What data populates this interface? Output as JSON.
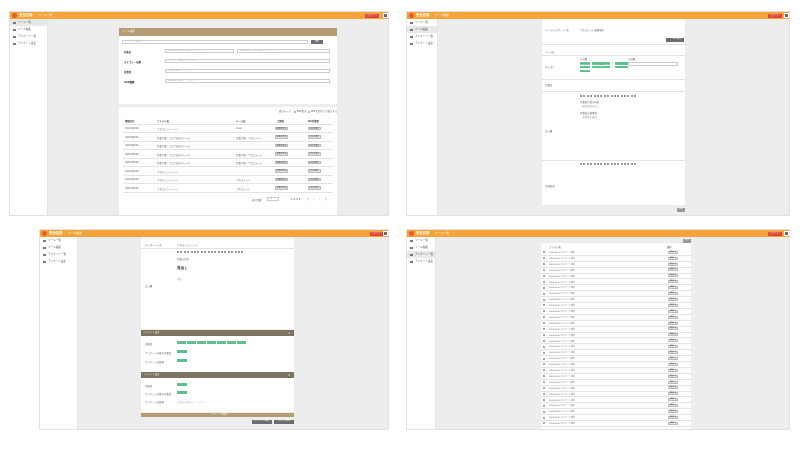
{
  "app": {
    "name": "安全日誌",
    "logout_label": "ログアウト",
    "crumb_list": "ツール一覧",
    "crumb_edit": "ツール編集",
    "crumb_form": "ツール編集"
  },
  "sidebar": [
    {
      "label": "ツール一覧"
    },
    {
      "label": "ツール編集"
    },
    {
      "label": "アンケート一覧"
    },
    {
      "label": "アンケート設定"
    }
  ],
  "screen1": {
    "panel_title": "ツール検索",
    "search_placeholder": "キーワードを検索",
    "search_button": "検索",
    "filters": [
      {
        "label": "対象日",
        "placeholder": "対象期間(開始日)を選択してください",
        "placeholder2": "対象期間(終了日)を選択してください"
      },
      {
        "label": "カテゴリー分類",
        "placeholder": "カテゴリーを選択してください"
      },
      {
        "label": "作業者",
        "placeholder": "作業者を選択してください"
      },
      {
        "label": "GAS種類",
        "placeholder": "GAS種類を選択してください"
      }
    ],
    "display_label": "表示モード",
    "display_opt1": "PDF表示",
    "display_opt2": "PDFを別タブで表示する",
    "columns": [
      "登録日付",
      "ファイル名",
      "ツール名",
      "工程区",
      "QA作業者"
    ],
    "rows": [
      {
        "date": "2020/06/01",
        "file": "アセスメントシート",
        "tool": "Liner",
        "b1": "詳細を見る",
        "b2": "PDFを開く"
      },
      {
        "date": "2020/06/01",
        "file": "作業手順・フロア表示(ツール)",
        "tool": "作業手順・アセスメント",
        "b1": "詳細を見る",
        "b2": "PDFを開く"
      },
      {
        "date": "2020/06/01",
        "file": "作業手順・フロア表示(ツール)",
        "tool": "",
        "b1": "詳細を見る",
        "b2": "PDFを開く"
      },
      {
        "date": "2020/06/01",
        "file": "作業手順・フロア表示(ツール)",
        "tool": "作業手順・アセスメント",
        "b1": "詳細を見る",
        "b2": "PDFを開く"
      },
      {
        "date": "2020/06/01",
        "file": "作業手順・フロア表示(ツール)",
        "tool": "作業手順・アセスメント",
        "b1": "詳細を見る",
        "b2": "PDFを開く"
      },
      {
        "date": "2020/06/01",
        "file": "アセスメントシート",
        "tool": "",
        "b1": "詳細を見る",
        "b2": "PDFを開く"
      },
      {
        "date": "2020/06/01",
        "file": "アセスメントシート",
        "tool": "アセスメント",
        "b1": "詳細を見る",
        "b2": "PDFを開く"
      },
      {
        "date": "2020/06/01",
        "file": "アセスメントシート",
        "tool": "アセスメント",
        "b1": "詳細を見る",
        "b2": "PDFを開く"
      }
    ],
    "pager_label": "表示件数",
    "pager_value": "10",
    "pager_info": "1-8 of 8"
  },
  "screen2": {
    "row0_label": "ツールテンプレート名",
    "row0_value": "アセスメント登録項目",
    "add_button": "ツールを追加",
    "row1_label": "ツール名",
    "row2_label": "カテゴリ",
    "cat_left_label": "大分類",
    "cat_right_label": "小分類",
    "tags": [
      "作業手順書",
      "アセスメント",
      "点検表",
      "チェックシート",
      "作業手順書",
      "アセスメント",
      "点検表",
      "チェックシート",
      "作業手順書"
    ],
    "row3_label": "作業者",
    "row4_label": "記入欄",
    "editor_line1": "作業者の指示内容",
    "editor_line2": "・確認事項を記入",
    "editor_line3": "作業前点検事項",
    "editor_line4": "・保護具の着用",
    "row5_label": "注意事項",
    "save_button": "保存"
  },
  "screen3": {
    "top_label": "テンプレート名",
    "top_value": "アセスメントシート",
    "editor_line1": "作業の目的",
    "editor_line2": "見出し",
    "editor_line3": "本文",
    "form_label": "記入欄",
    "sec1_title": "アンケート設定",
    "sec1_rows": [
      {
        "label": "対象者"
      },
      {
        "label": "アンケート対象の作業者"
      },
      {
        "label": "アンケート回答者"
      }
    ],
    "sec2_title": "アンケート設定",
    "sec2_rows": [
      {
        "label": "対象者"
      },
      {
        "label": "アンケート対象の作業者"
      },
      {
        "label": "アンケート回答者"
      }
    ],
    "sec2_placeholder": "回答者を選択してください",
    "add_bar": "アンケートを追加",
    "btn1": "テンプレートを保存",
    "btn2": "アンケートを保存"
  },
  "screen4": {
    "col1": "ファイル名",
    "col2": "操作",
    "top_button": "追加",
    "rows": [
      {
        "name": "2020-06-01 アンケート集計",
        "btn": "編集する"
      },
      {
        "name": "2020-06-01 アンケート集計",
        "btn": "編集する"
      },
      {
        "name": "2020-06-01 アンケート集計",
        "btn": "編集する"
      },
      {
        "name": "2020-06-01 アンケート集計",
        "btn": "編集する"
      },
      {
        "name": "2020-06-01 アンケート集計",
        "btn": "編集する"
      },
      {
        "name": "2020-06-01 アンケート集計",
        "btn": "編集する"
      },
      {
        "name": "2020-06-01 アンケート集計",
        "btn": "編集する"
      },
      {
        "name": "2020-06-01 アンケート集計",
        "btn": "編集する"
      },
      {
        "name": "2020-06-01 アンケート集計",
        "btn": "編集する"
      },
      {
        "name": "2020-06-01 アンケート集計",
        "btn": "編集する"
      },
      {
        "name": "2020-06-01 アンケート集計",
        "btn": "編集する"
      },
      {
        "name": "2020-06-01 アンケート集計",
        "btn": "編集する"
      },
      {
        "name": "2020-06-01 アンケート集計",
        "btn": "編集する"
      },
      {
        "name": "2020-06-01 アンケート集計",
        "btn": "編集する"
      },
      {
        "name": "2020-06-01 アンケート集計",
        "btn": "編集する"
      },
      {
        "name": "2020-06-01 アンケート集計",
        "btn": "編集する"
      },
      {
        "name": "2020-06-01 アンケート集計",
        "btn": "編集する"
      },
      {
        "name": "2020-06-01 アンケート集計",
        "btn": "編集する"
      },
      {
        "name": "2020-06-01 アンケート集計",
        "btn": "編集する"
      },
      {
        "name": "2020-06-01 アンケート集計",
        "btn": "編集する"
      },
      {
        "name": "2020-06-01 アンケート集計",
        "btn": "編集する"
      },
      {
        "name": "2020-06-01 アンケート集計",
        "btn": "編集する"
      },
      {
        "name": "2020-06-01 アンケート集計",
        "btn": "編集する"
      },
      {
        "name": "2020-06-01 アンケート集計",
        "btn": "編集する"
      },
      {
        "name": "2020-06-01 アンケート集計",
        "btn": "編集する"
      },
      {
        "name": "2020-06-01 アンケート集計",
        "btn": "編集する"
      },
      {
        "name": "2020-06-01 アンケート集計",
        "btn": "編集する"
      },
      {
        "name": "2020-06-01 アンケート集計",
        "btn": "編集する"
      },
      {
        "name": "2020-06-01 アンケート集計",
        "btn": "編集する"
      },
      {
        "name": "2020-06-01 アンケート集計",
        "btn": "編集する"
      }
    ]
  },
  "colors": {
    "topbar": "#f4a43a",
    "header": "#b49b73",
    "section_bar": "#7d7361",
    "tag": "#5fbf8a",
    "logout": "#e23d2c"
  }
}
